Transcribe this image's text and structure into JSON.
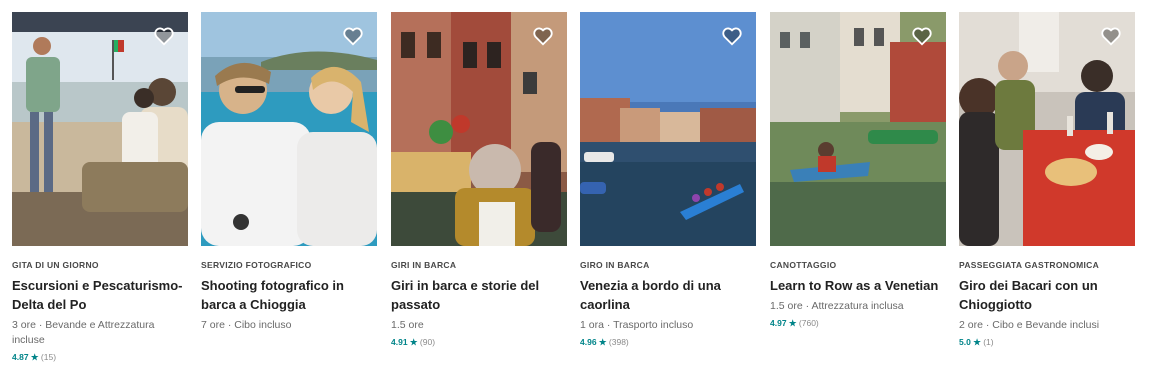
{
  "experiences": [
    {
      "category": "GITA DI UN GIORNO",
      "title": "Escursioni e Pescaturismo-Delta del Po",
      "meta": "3 ore · Bevande e Attrezzatura incluse",
      "rating": "4.87",
      "star": "★",
      "reviews": "(15)",
      "photo_subject": "boat-tour-people"
    },
    {
      "category": "SERVIZIO FOTOGRAFICO",
      "title": "Shooting fotografico in barca a Chioggia",
      "meta": "7 ore · Cibo incluso",
      "rating": "",
      "star": "",
      "reviews": "",
      "photo_subject": "couple-on-boat"
    },
    {
      "category": "GIRI IN BARCA",
      "title": "Giri in barca e storie del passato",
      "meta": "1.5 ore",
      "rating": "4.91",
      "star": "★",
      "reviews": "(90)",
      "photo_subject": "canal-houses-man"
    },
    {
      "category": "GIRO IN BARCA",
      "title": "Venezia a bordo di una caorlina",
      "meta": "1 ora · Trasporto incluso",
      "rating": "4.96",
      "star": "★",
      "reviews": "(398)",
      "photo_subject": "venice-canal-boat"
    },
    {
      "category": "CANOTTAGGIO",
      "title": "Learn to Row as a Venetian",
      "meta": "1.5 ore · Attrezzatura inclusa",
      "rating": "4.97",
      "star": "★",
      "reviews": "(760)",
      "photo_subject": "rowing-canal"
    },
    {
      "category": "PASSEGGIATA GASTRONOMICA",
      "title": "Giro dei Bacari con un Chioggiotto",
      "meta": "2 ore · Cibo e Bevande inclusi",
      "rating": "5.0",
      "star": "★",
      "reviews": "(1)",
      "photo_subject": "food-table-friends"
    }
  ],
  "icons": {
    "favorite": "heart-outline-icon"
  },
  "colors": {
    "rating": "#008489",
    "text": "#222222",
    "muted": "#6a6a6a"
  }
}
